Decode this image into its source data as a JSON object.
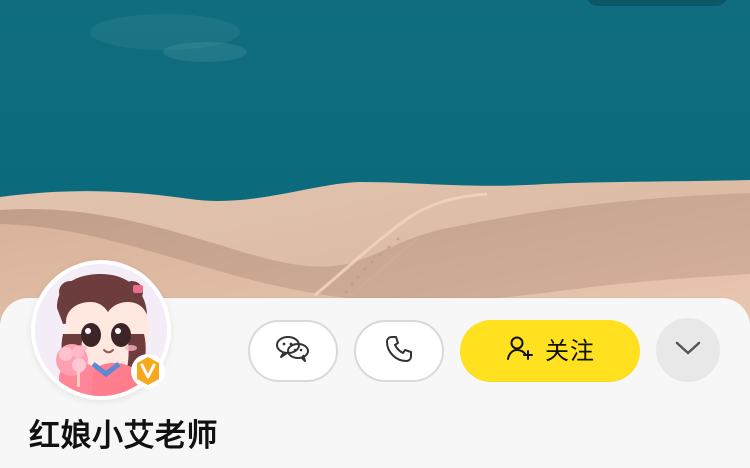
{
  "profile": {
    "name": "红娘小艾老师"
  },
  "actions": {
    "follow_label": "关注"
  },
  "icons": {
    "wechat": "wechat-icon",
    "phone": "phone-icon",
    "follow": "follow-user-icon",
    "more": "chevron-down-icon",
    "verified": "verified-v-icon"
  },
  "colors": {
    "follow_button": "#ffe11f",
    "badge": "#f7a81b",
    "outline": "#d9d9d9"
  }
}
